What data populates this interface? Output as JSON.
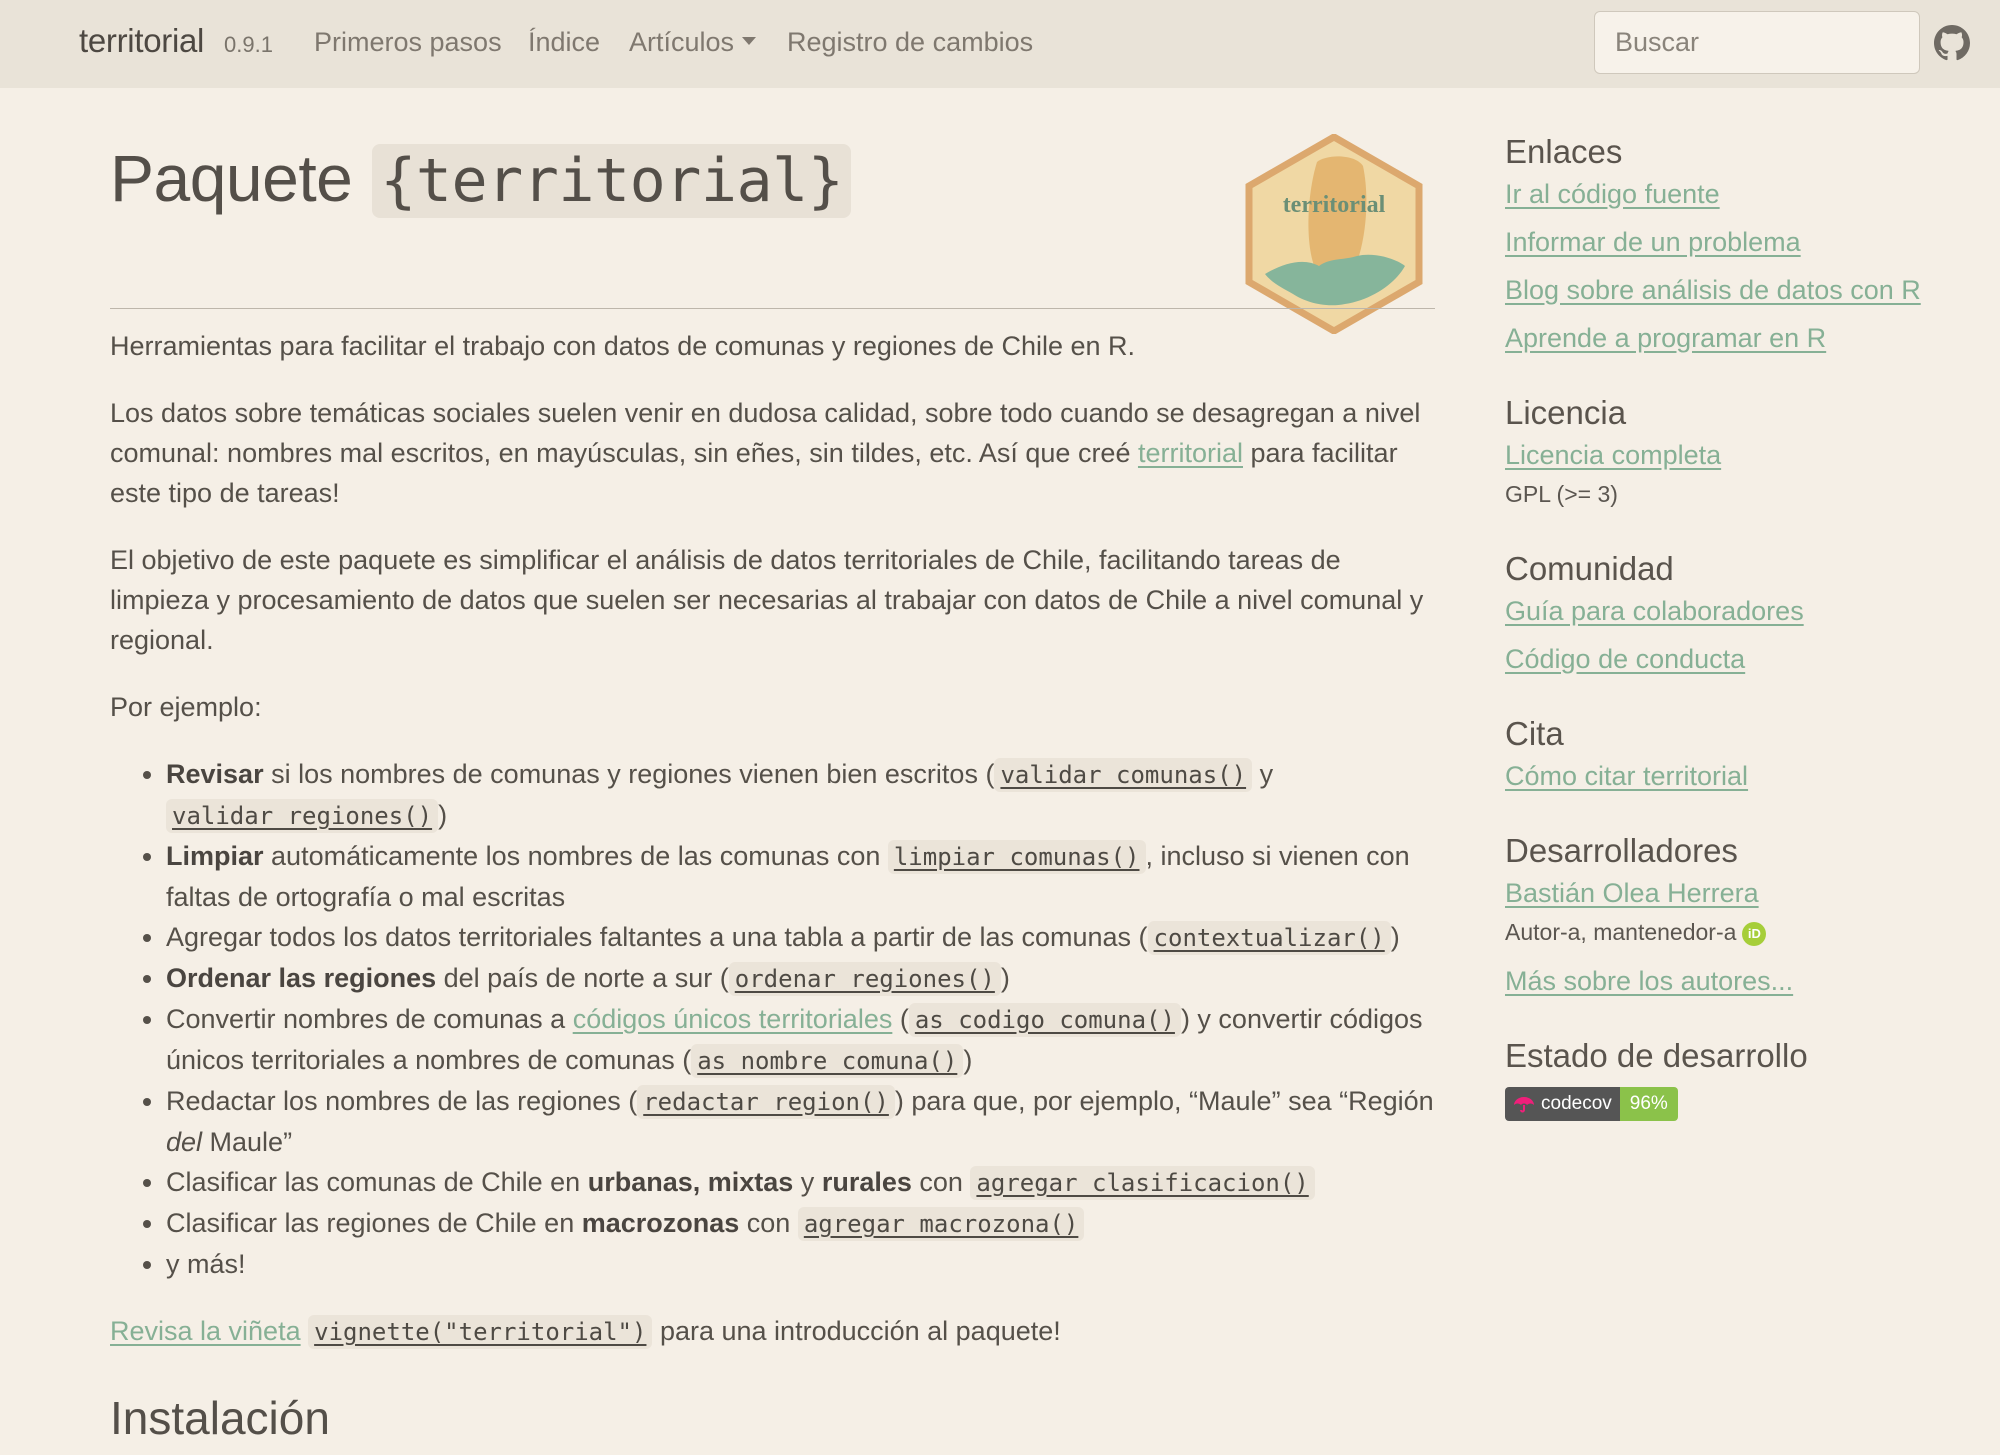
{
  "navbar": {
    "brand": "territorial",
    "version": "0.9.1",
    "links": [
      "Primeros pasos",
      "Índice",
      "Artículos",
      "Registro de cambios"
    ],
    "search_placeholder": "Buscar",
    "github_icon": "github-icon"
  },
  "main": {
    "title_text": "Paquete ",
    "title_code": "{territorial}",
    "logo_text": "territorial",
    "intro": "Herramientas para facilitar el trabajo con datos de comunas y regiones de Chile en R.",
    "p2_a": "Los datos sobre temáticas sociales suelen venir en dudosa calidad, sobre todo cuando se desagregan a nivel comunal: nombres mal escritos, en mayúsculas, sin eñes, sin tildes, etc. Así que creé ",
    "p2_link": "territorial",
    "p2_b": " para facilitar este tipo de tareas!",
    "p3": "El objetivo de este paquete es simplificar el análisis de datos territoriales de Chile, facilitando tareas de limpieza y procesamiento de datos que suelen ser necesarias al trabajar con datos de Chile a nivel comunal y regional.",
    "p4": "Por ejemplo:",
    "items": {
      "i1": {
        "bold": "Revisar",
        "t1": " si los nombres de comunas y regiones vienen bien escritos (",
        "c1": "validar_comunas()",
        "t2": " y ",
        "c2": "validar_regiones()",
        "t3": ")"
      },
      "i2": {
        "bold": "Limpiar",
        "t1": " automáticamente los nombres de las comunas con ",
        "c1": "limpiar_comunas()",
        "t2": ", incluso si vienen con faltas de ortografía o mal escritas"
      },
      "i3": {
        "t1": "Agregar todos los datos territoriales faltantes a una tabla a partir de las comunas (",
        "c1": "contextualizar()",
        "t2": ")"
      },
      "i4": {
        "bold": "Ordenar las regiones",
        "t1": " del país de norte a sur (",
        "c1": "ordenar_regiones()",
        "t2": ")"
      },
      "i5": {
        "t1": "Convertir nombres de comunas a ",
        "link": "códigos únicos territoriales",
        "t2": " (",
        "c1": "as_codigo_comuna()",
        "t3": ") y convertir códigos únicos territoriales a nombres de comunas (",
        "c2": "as_nombre_comuna()",
        "t4": ")"
      },
      "i6": {
        "t1": "Redactar los nombres de las regiones (",
        "c1": "redactar_region()",
        "t2": ") para que, por ejemplo, “Maule” sea “Región ",
        "em": "del",
        "t3": " Maule”"
      },
      "i7": {
        "t1": "Clasificar las comunas de Chile en ",
        "b1": "urbanas, mixtas",
        "t2": " y ",
        "b2": "rurales",
        "t3": " con ",
        "c1": "agregar_clasificacion()"
      },
      "i8": {
        "t1": "Clasificar las regiones de Chile en ",
        "b1": "macrozonas",
        "t2": " con ",
        "c1": "agregar_macrozona()"
      },
      "i9": {
        "t1": "y más!"
      }
    },
    "vignette_link": "Revisa la viñeta",
    "vignette_code": "vignette(\"territorial\")",
    "vignette_text": " para una introducción al paquete!",
    "section_heading": "Instalación"
  },
  "sidebar": {
    "links_heading": "Enlaces",
    "links": [
      "Ir al código fuente",
      "Informar de un problema",
      "Blog sobre análisis de datos con R",
      "Aprende a programar en R"
    ],
    "license_heading": "Licencia",
    "license_link": "Licencia completa",
    "license_text": "GPL (>= 3)",
    "community_heading": "Comunidad",
    "community_links": [
      "Guía para colaboradores",
      "Código de conducta"
    ],
    "cite_heading": "Cita",
    "cite_link": "Cómo citar territorial",
    "devs_heading": "Desarrolladores",
    "dev_name": "Bastián Olea Herrera",
    "dev_role": "Autor-a, mantenedor-a",
    "more_authors": "Más sobre los autores...",
    "status_heading": "Estado de desarrollo",
    "badge_label": "codecov",
    "badge_value": "96%"
  },
  "colors": {
    "background": "#f5efe6",
    "navbar": "#e9e3d8",
    "link": "#86b095",
    "text": "#555049"
  }
}
